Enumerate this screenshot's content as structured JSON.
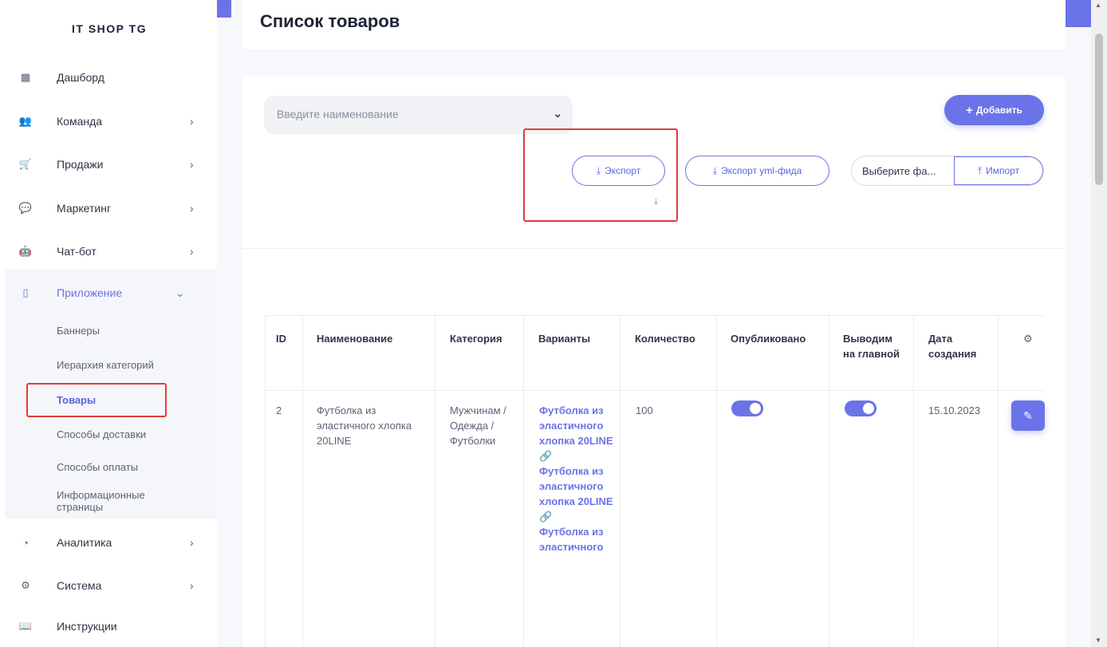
{
  "brand": "IT SHOP TG",
  "sidebar": {
    "items": [
      {
        "label": "Дашборд",
        "icon": "grid-icon",
        "glyph": "▦",
        "chevron": ""
      },
      {
        "label": "Команда",
        "icon": "users-icon",
        "glyph": "👥",
        "chevron": "›"
      },
      {
        "label": "Продажи",
        "icon": "cart-icon",
        "glyph": "🛒",
        "chevron": "›"
      },
      {
        "label": "Маркетинг",
        "icon": "comments-icon",
        "glyph": "💬",
        "chevron": "›"
      },
      {
        "label": "Чат-бот",
        "icon": "robot-icon",
        "glyph": "🤖",
        "chevron": "›"
      },
      {
        "label": "Приложение",
        "icon": "mobile-icon",
        "glyph": "▯",
        "chevron": "⌄"
      },
      {
        "label": "Аналитика",
        "icon": "pie-chart-icon",
        "glyph": "◔",
        "chevron": "›"
      },
      {
        "label": "Система",
        "icon": "cogs-icon",
        "glyph": "⚙",
        "chevron": "›"
      },
      {
        "label": "Инструкции",
        "icon": "book-icon",
        "glyph": "📖",
        "chevron": ""
      }
    ],
    "submenu": [
      "Баннеры",
      "Иерархия категорий",
      "Товары",
      "Способы доставки",
      "Способы оплаты",
      "Информационные страницы"
    ]
  },
  "page": {
    "title": "Список товаров"
  },
  "search": {
    "placeholder": "Введите наименование",
    "chevron": "⌄"
  },
  "toolbar": {
    "add_label": "Добавить",
    "add_glyph": "+",
    "export_label": "Экспорт",
    "export_yml_label": "Экспорт yml-фида",
    "file_placeholder": "Выберите фа...",
    "import_label": "Импорт",
    "download_glyph": "⤓",
    "upload_glyph": "⤒"
  },
  "table": {
    "headers": [
      "ID",
      "Наименование",
      "Категория",
      "Варианты",
      "Количество",
      "Опубликовано",
      "Выводим на главной",
      "Дата создания"
    ],
    "rows": [
      {
        "id": "2",
        "name": "Футболка из эластичного хлопка 20LINE",
        "category": "Мужчинам / Одежда / Футболки",
        "variants": [
          "Футболка из эластичного хлопка 20LINE",
          "Футболка из эластичного хлопка 20LINE",
          "Футболка из эластичного"
        ],
        "quantity": "100",
        "published": true,
        "featured": true,
        "created": "15.10.2023"
      }
    ]
  },
  "colors": {
    "accent": "#6b73e8",
    "highlight": "#e23b3b"
  }
}
